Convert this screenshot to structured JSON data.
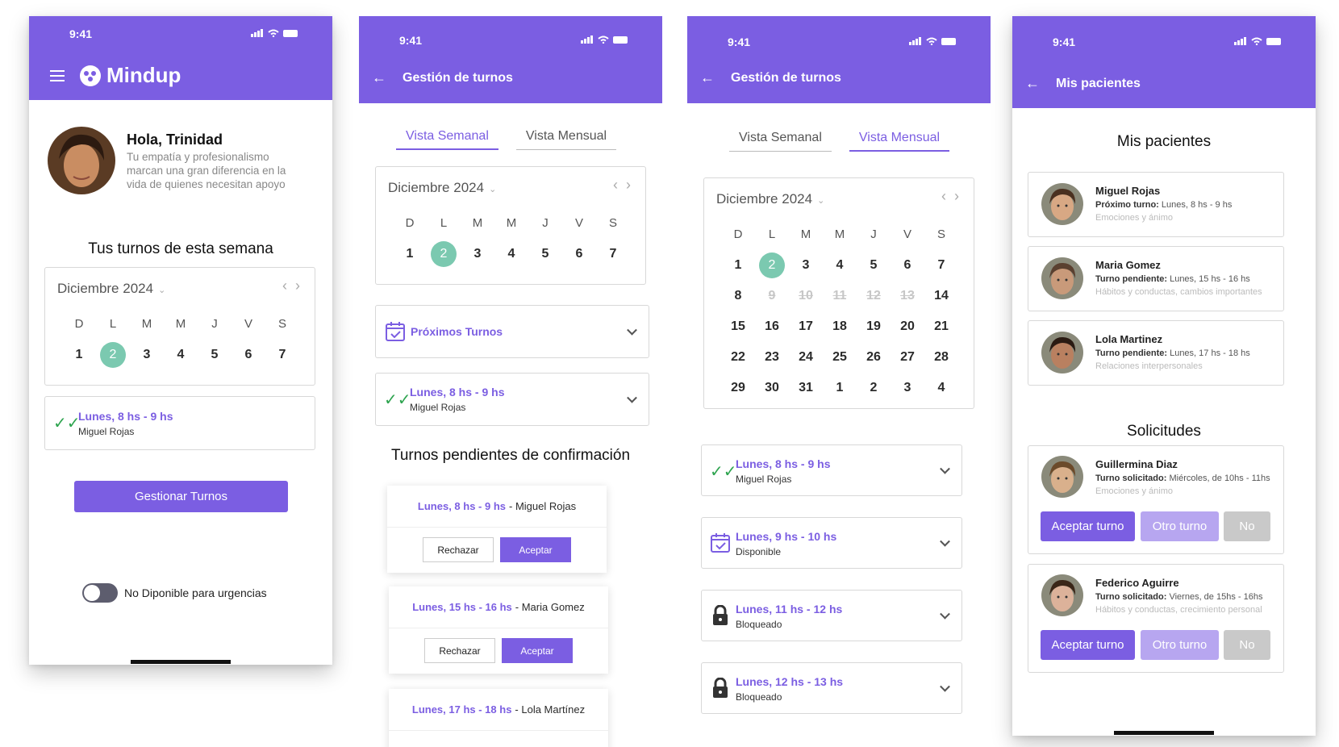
{
  "colors": {
    "brand": "#7b5ee2",
    "selected_day": "#7bc9b0",
    "check": "#2ea44f",
    "light_purple": "#b7a6f0",
    "disabled": "#c9c9c9"
  },
  "status_time": "9:41",
  "weekdays": [
    "D",
    "L",
    "M",
    "M",
    "J",
    "V",
    "S"
  ],
  "month_label": "Diciembre 2024",
  "screen1": {
    "brand": "Mindup",
    "greeting": "Hola, Trinidad",
    "subtitle": "Tu empatía y profesionalismo marcan una gran diferencia en la vida de quienes necesitan apoyo",
    "week_title": "Tus turnos de esta semana",
    "week_days": [
      "1",
      "2",
      "3",
      "4",
      "5",
      "6",
      "7"
    ],
    "selected_day": "2",
    "slot": {
      "title": "Lunes, 8 hs - 9 hs",
      "patient": "Miguel Rojas"
    },
    "manage_button": "Gestionar Turnos",
    "toggle_label": "No Diponible para urgencias"
  },
  "screen2": {
    "title": "Gestión de turnos",
    "tabs": [
      "Vista Semanal",
      "Vista Mensual"
    ],
    "active_tab": "Vista Semanal",
    "upcoming_label": "Próximos Turnos",
    "slot": {
      "title": "Lunes, 8 hs - 9 hs",
      "patient": "Miguel Rojas"
    },
    "pending_title": "Turnos pendientes de confirmación",
    "pending": [
      {
        "time": "Lunes, 8 hs - 9 hs",
        "name": "- Miguel Rojas"
      },
      {
        "time": "Lunes, 15 hs - 16 hs",
        "name": "- Maria Gomez"
      },
      {
        "time": "Lunes, 17 hs - 18 hs",
        "name": "- Lola Martínez"
      }
    ],
    "reject_label": "Rechazar",
    "accept_label": "Aceptar"
  },
  "screen3": {
    "title": "Gestión de turnos",
    "tabs": [
      "Vista Semanal",
      "Vista Mensual"
    ],
    "active_tab": "Vista Mensual",
    "month_rows": [
      [
        "1",
        "2",
        "3",
        "4",
        "5",
        "6",
        "7"
      ],
      [
        "8",
        "9",
        "10",
        "11",
        "12",
        "13",
        "14"
      ],
      [
        "15",
        "16",
        "17",
        "18",
        "19",
        "20",
        "21"
      ],
      [
        "22",
        "23",
        "24",
        "25",
        "26",
        "27",
        "28"
      ],
      [
        "29",
        "30",
        "31",
        "1",
        "2",
        "3",
        "4"
      ]
    ],
    "disabled_days": [
      "9",
      "10",
      "11",
      "12",
      "13"
    ],
    "slots": [
      {
        "title": "Lunes, 8 hs - 9 hs",
        "status": "Miguel Rojas",
        "icon": "double-check-icon"
      },
      {
        "title": "Lunes, 9 hs - 10 hs",
        "status": "Disponible",
        "icon": "calendar-check-icon"
      },
      {
        "title": "Lunes, 11 hs - 12 hs",
        "status": "Bloqueado",
        "icon": "lock-icon"
      },
      {
        "title": "Lunes, 12 hs - 13 hs",
        "status": "Bloqueado",
        "icon": "lock-icon"
      }
    ]
  },
  "screen4": {
    "header_title": "Mis pacientes",
    "section_title": "Mis pacientes",
    "patients": [
      {
        "name": "Miguel Rojas",
        "label": "Próximo turno:",
        "detail": "Lunes, 8 hs - 9 hs",
        "tag": "Emociones y ánimo"
      },
      {
        "name": "Maria Gomez",
        "label": "Turno pendiente:",
        "detail": "Lunes, 15 hs - 16 hs",
        "tag": "Hábitos y conductas, cambios importantes"
      },
      {
        "name": "Lola Martinez",
        "label": "Turno pendiente:",
        "detail": "Lunes, 17 hs - 18 hs",
        "tag": "Relaciones interpersonales"
      }
    ],
    "requests_title": "Solicitudes",
    "requests": [
      {
        "name": "Guillermina Diaz",
        "label": "Turno solicitado:",
        "detail": "Miércoles, de 10hs - 11hs",
        "tag": "Emociones y ánimo"
      },
      {
        "name": "Federico Aguirre",
        "label": "Turno solicitado:",
        "detail": "Viernes, de 15hs - 16hs",
        "tag": "Hábitos y conductas, crecimiento personal"
      }
    ],
    "accept_label": "Aceptar turno",
    "other_label": "Otro turno",
    "no_label": "No"
  }
}
